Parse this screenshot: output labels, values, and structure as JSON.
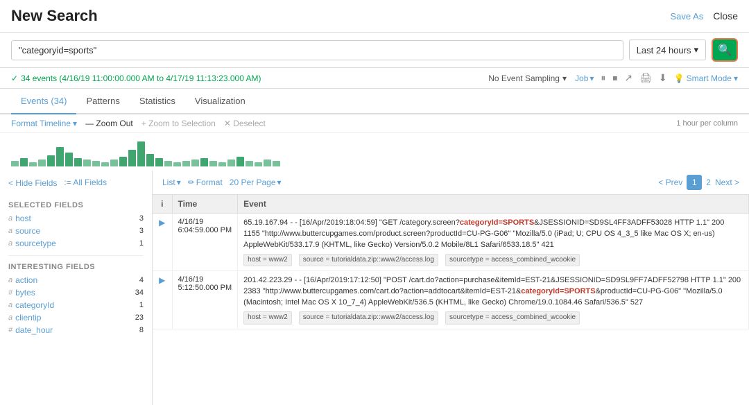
{
  "header": {
    "title": "New Search",
    "save_as_label": "Save As",
    "close_label": "Close"
  },
  "search": {
    "query": "\"categoryid=sports\"",
    "time_range": "Last 24 hours",
    "search_icon": "🔍"
  },
  "events_bar": {
    "checkmark": "✓",
    "count_text": "34 events (4/16/19 11:00:00.000 AM to 4/17/19 11:13:23.000 AM)",
    "sampling_label": "No Event Sampling",
    "job_label": "Job",
    "smart_mode_label": "Smart Mode"
  },
  "tabs": [
    {
      "label": "Events (34)",
      "active": true
    },
    {
      "label": "Patterns",
      "active": false
    },
    {
      "label": "Statistics",
      "active": false
    },
    {
      "label": "Visualization",
      "active": false
    }
  ],
  "timeline": {
    "format_label": "Format Timeline",
    "zoom_out_label": "— Zoom Out",
    "zoom_selection_label": "+ Zoom to Selection",
    "deselect_label": "✕ Deselect",
    "per_col_label": "1 hour per column"
  },
  "histogram_bars": [
    4,
    6,
    3,
    5,
    8,
    14,
    10,
    6,
    5,
    4,
    3,
    5,
    7,
    12,
    18,
    9,
    6,
    4,
    3,
    4,
    5,
    6,
    4,
    3,
    5,
    7,
    4,
    3,
    5,
    4
  ],
  "sidebar": {
    "hide_fields_label": "< Hide Fields",
    "all_fields_label": ":= All Fields",
    "selected_section": "SELECTED FIELDS",
    "selected_fields": [
      {
        "type": "a",
        "name": "host",
        "count": "3"
      },
      {
        "type": "a",
        "name": "source",
        "count": "3"
      },
      {
        "type": "a",
        "name": "sourcetype",
        "count": "1"
      }
    ],
    "interesting_section": "INTERESTING FIELDS",
    "interesting_fields": [
      {
        "type": "a",
        "name": "action",
        "count": "4"
      },
      {
        "type": "#",
        "name": "bytes",
        "count": "34"
      },
      {
        "type": "a",
        "name": "categoryId",
        "count": "1"
      },
      {
        "type": "a",
        "name": "clientip",
        "count": "23"
      },
      {
        "type": "#",
        "name": "date_hour",
        "count": "8"
      }
    ]
  },
  "results_toolbar": {
    "list_label": "List",
    "format_label": "Format",
    "per_page_label": "20 Per Page",
    "prev_label": "< Prev",
    "page_1": "1",
    "page_2": "2",
    "next_label": "Next >"
  },
  "table": {
    "headers": [
      "i",
      "Time",
      "Event"
    ],
    "rows": [
      {
        "expand": "▶",
        "time": "4/16/19\n6:04:59.000 PM",
        "event_text": "65.19.167.94 - - [16/Apr/2019:18:04:59] \"GET /category.screen?",
        "event_highlight": "categoryId=SPORTS",
        "event_text2": "&JSESSIONID=SD9SL4FF3ADFF53028 HTTP 1.1\" 200 1155 \"http://www.buttercupgames.com/product.screen?productId=CU-PG-G06\" \"Mozilla/5.0 (iPad; U; CPU OS 4_3_5 like Mac OS X; en-us) AppleWebKit/533.17.9 (KHTML, like Gecko) Version/5.0.2 Mobile/8L1 Safari/6533.18.5\" 421",
        "meta": [
          {
            "key": "host",
            "val": "www2"
          },
          {
            "key": "source",
            "val": "tutorialdata.zip::www2/access.log"
          },
          {
            "key": "sourcetype",
            "val": "access_combined_wcookie"
          }
        ]
      },
      {
        "expand": "▶",
        "time": "4/16/19\n5:12:50.000 PM",
        "event_text": "201.42.223.29 - - [16/Apr/2019:17:12:50] \"POST /cart.do?action=purchase&itemId=EST-21&JSESSIONID=SD9SL9FF7ADFF52798 HTTP 1.1\" 200 2383 \"http://www.buttercupgames.com/cart.do?action=addtocart&itemId=EST-21&",
        "event_highlight": "categoryId=SPORTS",
        "event_text2": "&productId=CU-PG-G06\" \"Mozilla/5.0 (Macintosh; Intel Mac OS X 10_7_4) AppleWebKit/536.5 (KHTML, like Gecko) Chrome/19.0.1084.46 Safari/536.5\" 527",
        "meta": [
          {
            "key": "host",
            "val": "www2"
          },
          {
            "key": "source",
            "val": "tutorialdata.zip::www2/access.log"
          },
          {
            "key": "sourcetype",
            "val": "access_combined_wcookie"
          }
        ]
      }
    ]
  }
}
